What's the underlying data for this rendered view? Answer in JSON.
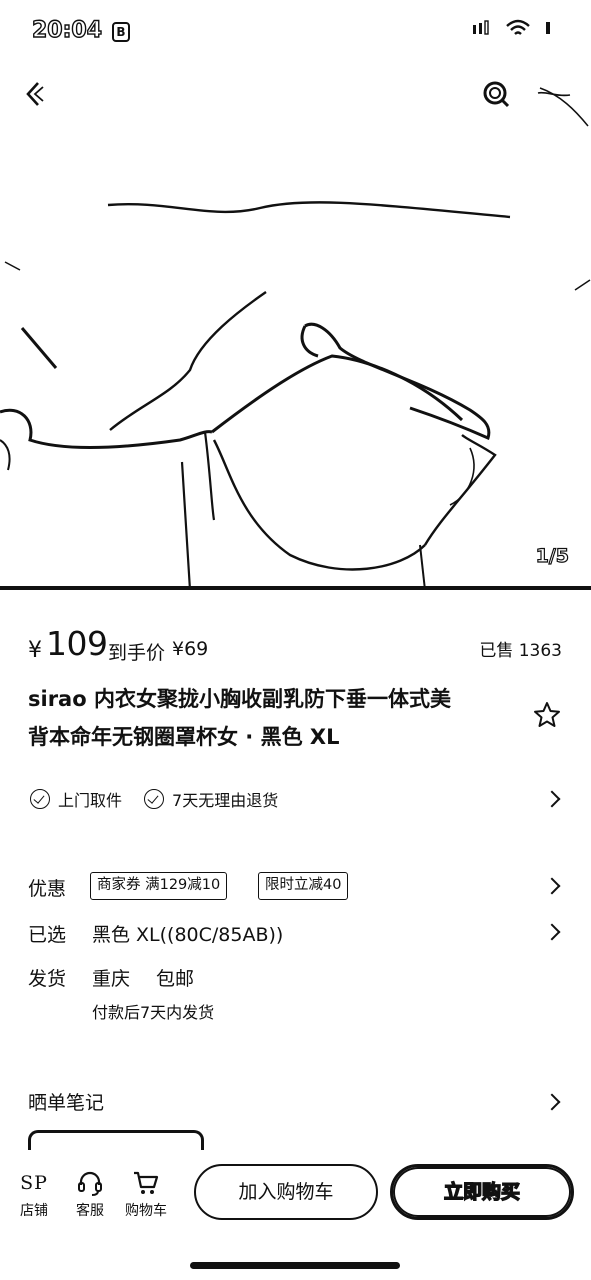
{
  "status_bar": {
    "time": "20:04",
    "badge": "B"
  },
  "gallery": {
    "page_indicator": "1/5"
  },
  "price": {
    "currency": "¥",
    "main": "109",
    "deal_label": "到手价",
    "deal_price": "¥69",
    "sold": "已售 1363"
  },
  "product": {
    "title_line1": "sirao 内衣女聚拢小胸收副乳防下垂一体式美",
    "title_line2": "背本命年无钢圈罩杯女 · 黑色 XL"
  },
  "services": [
    {
      "label": "上门取件"
    },
    {
      "label": "7天无理由退货"
    }
  ],
  "offers": {
    "label": "优惠",
    "tags": [
      "商家券  满129减10",
      "限时立减40"
    ]
  },
  "selected": {
    "label": "已选",
    "value": "黑色 XL((80C/85AB))"
  },
  "shipping": {
    "label": "发货",
    "from": "重庆",
    "fee": "包邮",
    "note": "付款后7天内发货"
  },
  "notes": {
    "label": "晒单笔记"
  },
  "bottom_nav": {
    "store_glyph": "SP",
    "store": "店铺",
    "service": "客服",
    "cart": "购物车",
    "add_to_cart": "加入购物车",
    "buy_now": "立即购买"
  },
  "icons": [
    "back-icon",
    "search-icon",
    "more-icon",
    "star-icon",
    "check-circle-icon",
    "chevron-right-icon",
    "headset-icon",
    "cart-icon",
    "signal-icon",
    "wifi-icon",
    "battery-icon"
  ]
}
